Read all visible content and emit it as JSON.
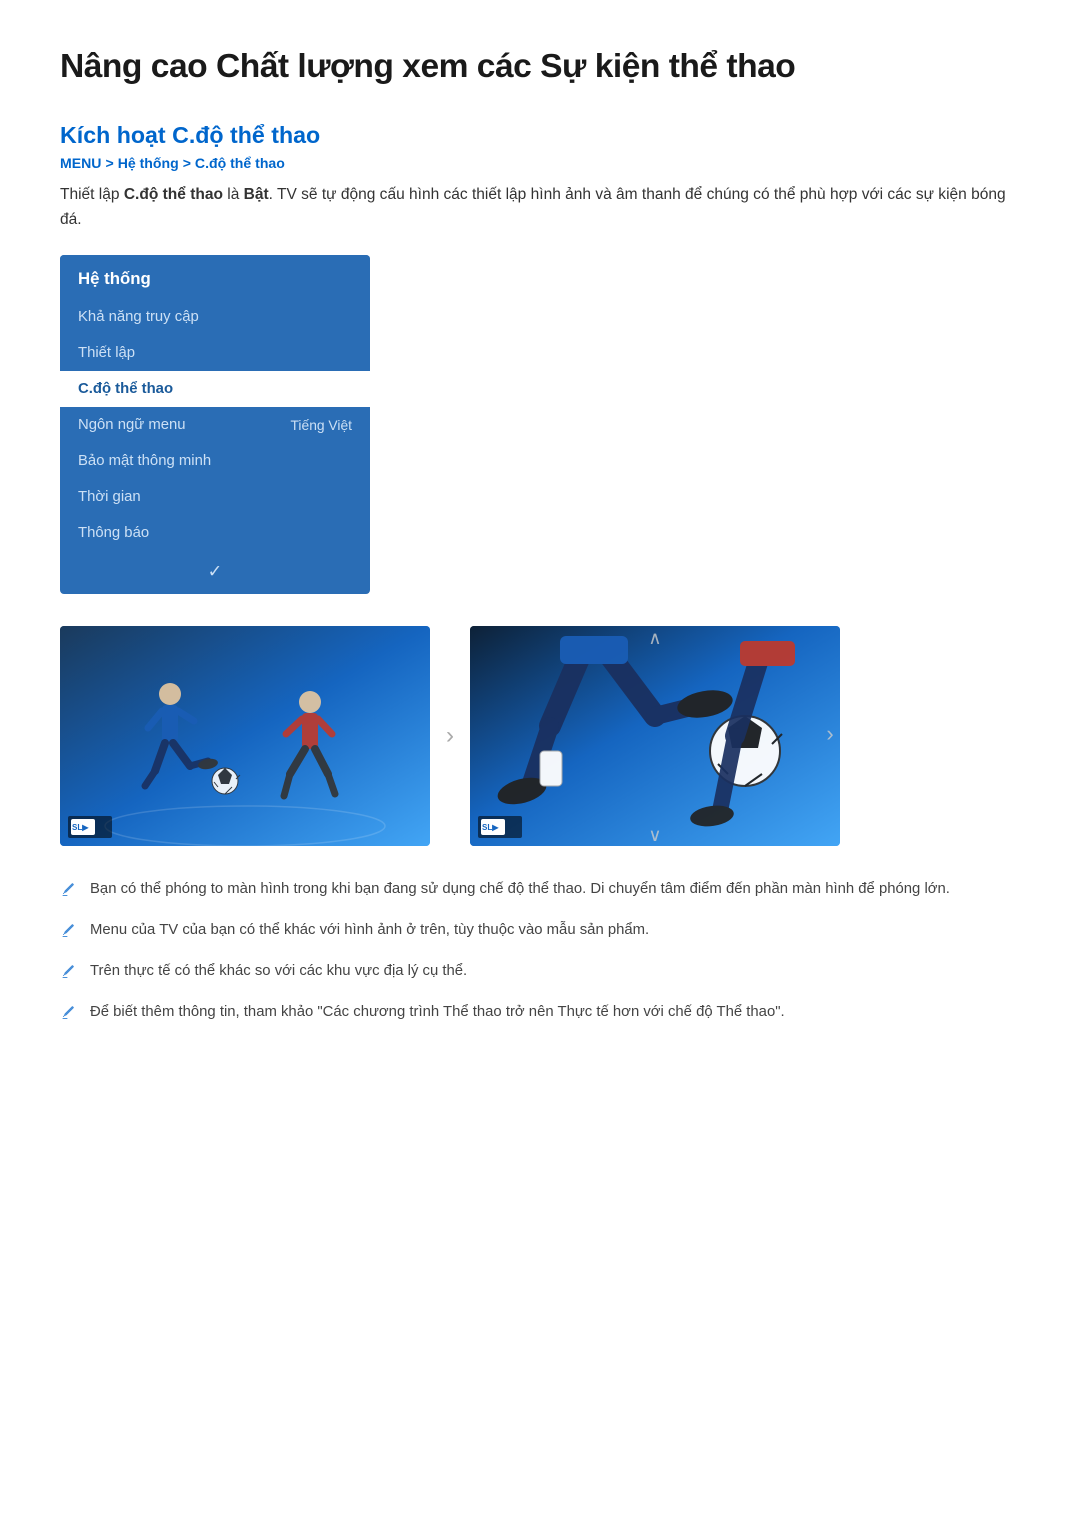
{
  "page": {
    "title": "Nâng cao Chất lượng xem các Sự kiện thể thao"
  },
  "section": {
    "title": "Kích hoạt C.độ thể thao",
    "breadcrumb": {
      "menu": "MENU",
      "sep1": ">",
      "item1": "Hệ thống",
      "sep2": ">",
      "item2": "C.độ thể thao"
    },
    "intro": "Thiết lập ",
    "intro_bold1": "C.độ thể thao",
    "intro_mid": " là ",
    "intro_bold2": "Bật",
    "intro_end": ". TV sẽ tự động cấu hình các thiết lập hình ảnh và âm thanh để chúng có thể phù hợp với các sự kiện bóng đá."
  },
  "menu_panel": {
    "header": "Hệ thống",
    "items": [
      {
        "label": "Khả năng truy cập",
        "value": "",
        "active": false
      },
      {
        "label": "Thiết lập",
        "value": "",
        "active": false
      },
      {
        "label": "C.độ thể thao",
        "value": "",
        "active": true
      },
      {
        "label": "Ngôn ngữ menu",
        "value": "Tiếng Việt",
        "active": false
      },
      {
        "label": "Bảo mật thông minh",
        "value": "",
        "active": false
      },
      {
        "label": "Thời gian",
        "value": "",
        "active": false
      },
      {
        "label": "Thông báo",
        "value": "",
        "active": false
      }
    ]
  },
  "images": {
    "left_alt": "Soccer players before sports mode - standard view",
    "right_alt": "Soccer players after sports mode - enhanced close-up view",
    "badge_text": "SL▶",
    "arrow": "›"
  },
  "notes": [
    "Bạn có thể phóng to màn hình trong khi bạn đang sử dụng chế độ thể thao. Di chuyển tâm điểm đến phần màn hình để phóng lớn.",
    "Menu của TV của bạn có thể khác với hình ảnh ở trên, tùy thuộc vào mẫu sản phẩm.",
    "Trên thực tế có thể khác so với các khu vực địa lý cụ thể.",
    "Để biết thêm thông tin, tham khảo \"Các chương trình Thể thao trở nên Thực tế hơn với chế độ Thể thao\"."
  ]
}
